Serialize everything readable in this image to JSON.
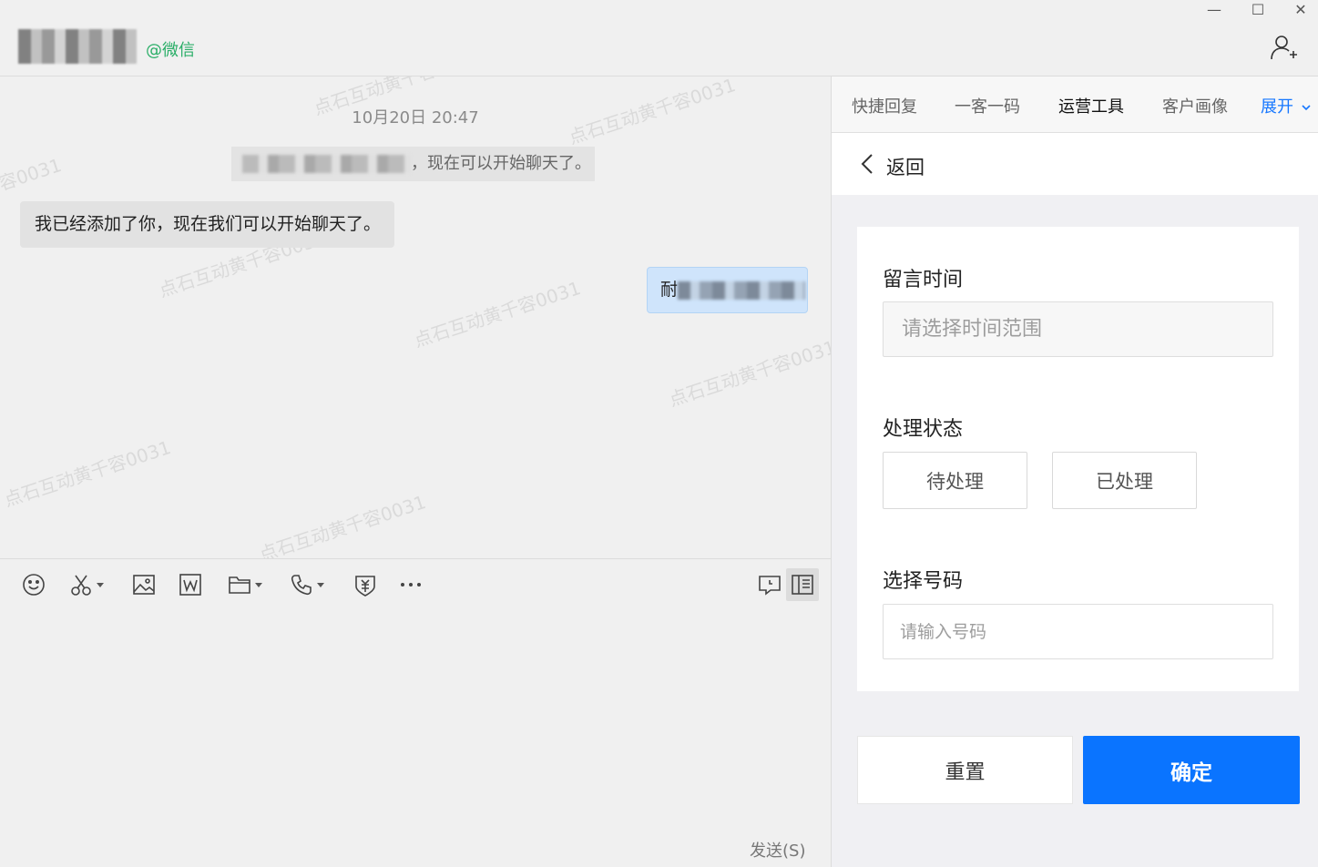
{
  "titlebar": {
    "contact_platform": "@微信",
    "controls": {
      "minimize": "—",
      "maximize": "☐",
      "close": "✕"
    }
  },
  "chat": {
    "watermark": "点石互动黄千容0031",
    "timestamp": "10月20日 20:47",
    "system_message_suffix": "，现在可以开始聊天了。",
    "incoming_message": "我已经添加了你，现在我们可以开始聊天了。",
    "outgoing_message_prefix": "耐"
  },
  "toolbar": {
    "icons": [
      "emoji-icon",
      "scissors-icon",
      "image-icon",
      "word-icon",
      "folder-icon",
      "phone-icon",
      "redpacket-icon",
      "more-icon",
      "chat-history-icon",
      "side-panel-icon"
    ]
  },
  "input": {
    "send_label": "发送(S)"
  },
  "panel": {
    "tabs": [
      {
        "label": "快捷回复"
      },
      {
        "label": "一客一码"
      },
      {
        "label": "运营工具"
      },
      {
        "label": "客户画像"
      }
    ],
    "expand_label": "展开",
    "back_label": "返回",
    "form": {
      "time_label": "留言时间",
      "time_placeholder": "请选择时间范围",
      "status_label": "处理状态",
      "status_options": [
        "待处理",
        "已处理"
      ],
      "number_label": "选择号码",
      "number_placeholder": "请输入号码"
    },
    "reset_label": "重置",
    "confirm_label": "确定"
  },
  "colors": {
    "accent": "#0a74ff",
    "platform": "#2aae67",
    "outgoing_bubble": "#cfe4fb"
  }
}
